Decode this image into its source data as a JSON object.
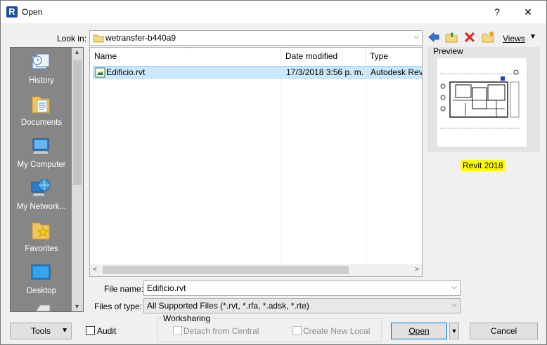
{
  "window": {
    "title": "Open",
    "app_icon_letter": "R",
    "help_glyph": "?",
    "close_glyph": "✕"
  },
  "lookin": {
    "label": "Look in:",
    "value": "wetransfer-b440a9"
  },
  "toolbar": {
    "views_label": "Views"
  },
  "places": [
    {
      "label": "History"
    },
    {
      "label": "Documents"
    },
    {
      "label": "My Computer"
    },
    {
      "label": "My Network..."
    },
    {
      "label": "Favorites"
    },
    {
      "label": "Desktop"
    }
  ],
  "filelist": {
    "columns": [
      "Name",
      "Date modified",
      "Type"
    ],
    "rows": [
      {
        "name": "Edificio.rvt",
        "date": "17/3/2018 3:56 p. m.",
        "type": "Autodesk Revi"
      }
    ]
  },
  "preview": {
    "label": "Preview",
    "version_badge": "Revit 2018"
  },
  "filename": {
    "label": "File name:",
    "value": "Edificio.rvt"
  },
  "filetype": {
    "label": "Files of type:",
    "value": "All Supported Files  (*.rvt, *.rfa, *.adsk, *.rte)"
  },
  "buttons": {
    "tools": "Tools",
    "open": "Open",
    "cancel": "Cancel"
  },
  "audit": {
    "label": "Audit"
  },
  "worksharing": {
    "legend": "Worksharing",
    "detach": "Detach from Central",
    "create_local": "Create New Local"
  },
  "colors": {
    "selection": "#cce8ff",
    "highlight": "#ffff00",
    "places_bg": "#868686"
  }
}
